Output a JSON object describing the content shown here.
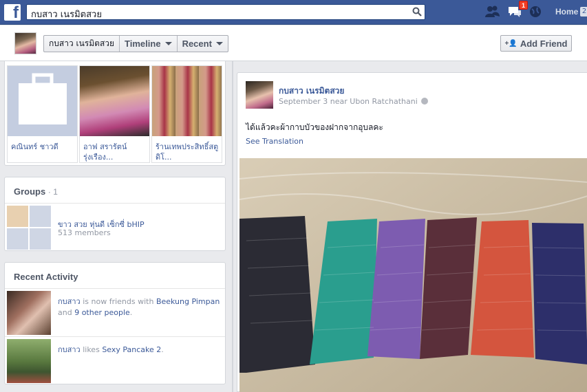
{
  "topbar": {
    "search_value": "กบสาว เนรมิตสวย",
    "notification_count": "1",
    "home_label": "Home",
    "home_count": "2"
  },
  "profile_bar": {
    "name": "กบสาว เนรมิตสวย",
    "timeline_label": "Timeline",
    "recent_label": "Recent",
    "add_friend_label": "Add Friend"
  },
  "photos": [
    {
      "caption": "คณินทร์ ชาวดี",
      "kind": "placeholder"
    },
    {
      "caption": "อาฟ สรารัตน์ รุ่งเรือง...",
      "kind": "portrait"
    },
    {
      "caption": "ร้านเทพประสิทธิ์สตูดิโ...",
      "kind": "dresses"
    }
  ],
  "groups": {
    "title": "Groups",
    "count": "· 1",
    "items": [
      {
        "name": "ขาว สวย หุ่นดี เซ็กซี่ bHIP",
        "members": "513 members"
      }
    ]
  },
  "recent_activity": {
    "title": "Recent Activity",
    "items": [
      {
        "actor": "กบสาว",
        "text_pre": "is now friends with",
        "link1": "Beekung Pimpan",
        "text_mid": "and",
        "link2": "9 other people",
        "text_post": "."
      },
      {
        "actor": "กบสาว",
        "text_pre": "likes",
        "link1": "Sexy Pancake 2",
        "text_mid": "",
        "link2": "",
        "text_post": "."
      }
    ]
  },
  "post": {
    "author": "กบสาว เนรมิตสวย",
    "meta": "September 3 near Ubon Ratchathani",
    "text": "ได้แล้วคะผ้ากาบบัวของฝากจากอุบลคะ",
    "see_translation": "See Translation"
  },
  "colors": {
    "brand": "#3b5998",
    "badge": "#f03d25"
  }
}
